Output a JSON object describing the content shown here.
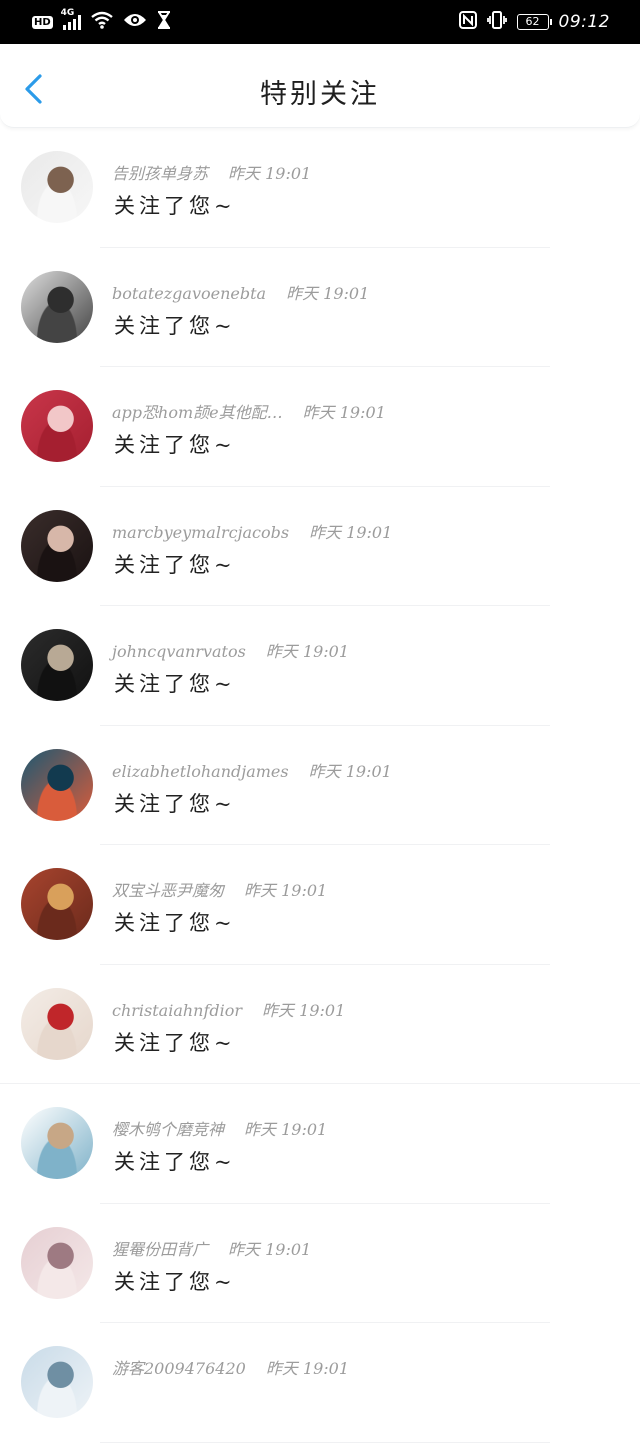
{
  "status_bar": {
    "hd": "HD",
    "network": "4G",
    "battery": "62",
    "time": "09:12"
  },
  "header": {
    "back_icon": "chevron-left-icon",
    "title": "特别关注"
  },
  "accent_color": "#2b9be9",
  "items": [
    {
      "name": "告别孩单身苏",
      "time": "昨天 19:01",
      "message": "关注了您~",
      "avatar_colors": [
        "#e9e9e9",
        "#7d6250",
        "#f7f7f7"
      ]
    },
    {
      "name": "botatezgavoenebta",
      "time": "昨天 19:01",
      "message": "关注了您~",
      "avatar_colors": [
        "#dedede",
        "#2e2e2e",
        "#444444"
      ]
    },
    {
      "name": "app恐hom颉e其他配…",
      "time": "昨天 19:01",
      "message": "关注了您~",
      "avatar_colors": [
        "#c9364a",
        "#f2c7c8",
        "#a51f30"
      ]
    },
    {
      "name": "marcbyeymalrcjacobs",
      "time": "昨天 19:01",
      "message": "关注了您~",
      "avatar_colors": [
        "#3a2d2b",
        "#d7b7a9",
        "#1a1212"
      ]
    },
    {
      "name": "johncqvanrvatos",
      "time": "昨天 19:01",
      "message": "关注了您~",
      "avatar_colors": [
        "#2c2c2c",
        "#b8a995",
        "#111111"
      ]
    },
    {
      "name": "elizabhetlohandjames",
      "time": "昨天 19:01",
      "message": "关注了您~",
      "avatar_colors": [
        "#1d5872",
        "#123a4f",
        "#d95c3b"
      ]
    },
    {
      "name": "双宝斗恶尹魔匆",
      "time": "昨天 19:01",
      "message": "关注了您~",
      "avatar_colors": [
        "#a8442e",
        "#d9a05b",
        "#6b2a1c"
      ]
    },
    {
      "name": "christaiahnfdior",
      "time": "昨天 19:01",
      "message": "关注了您~",
      "avatar_colors": [
        "#f3ece6",
        "#c0262a",
        "#e6d7cc"
      ]
    },
    {
      "name": "樱木鸲个磨竞神",
      "time": "昨天 19:01",
      "message": "关注了您~",
      "avatar_colors": [
        "#ffffff",
        "#c7a786",
        "#7fb2c9"
      ]
    },
    {
      "name": "猩罨份田背广",
      "time": "昨天 19:01",
      "message": "关注了您~",
      "avatar_colors": [
        "#e6cfd3",
        "#9e7a82",
        "#f4e8e8"
      ]
    },
    {
      "name": "游客2009476420",
      "time": "昨天 19:01",
      "message": "",
      "avatar_colors": [
        "#c9dbe8",
        "#6f8fa3",
        "#eef3f7"
      ]
    }
  ]
}
